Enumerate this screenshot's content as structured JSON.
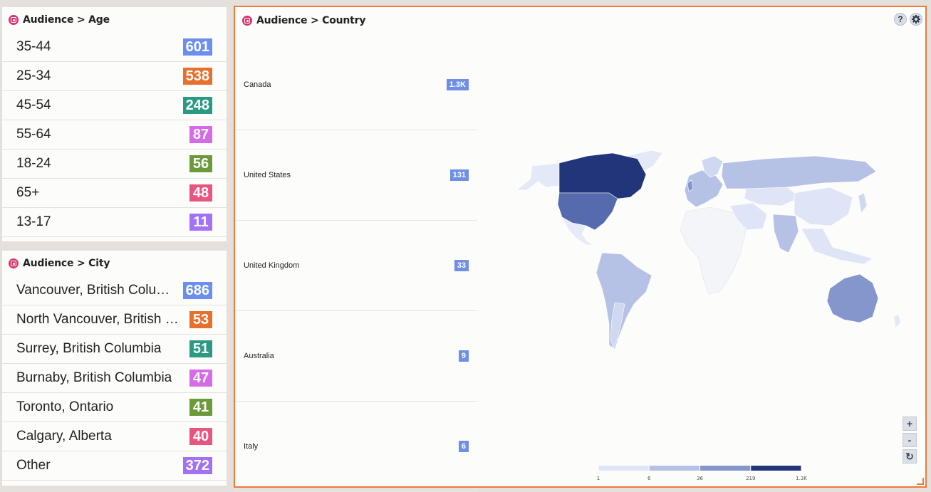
{
  "age_panel": {
    "title": "Audience > Age",
    "rows": [
      {
        "label": "35-44",
        "value": "601",
        "color": "#6b8ef0"
      },
      {
        "label": "25-34",
        "value": "538",
        "color": "#e8702d"
      },
      {
        "label": "45-54",
        "value": "248",
        "color": "#2b9a82"
      },
      {
        "label": "55-64",
        "value": "87",
        "color": "#d56be6"
      },
      {
        "label": "18-24",
        "value": "56",
        "color": "#6c9a3a"
      },
      {
        "label": "65+",
        "value": "48",
        "color": "#ea5580"
      },
      {
        "label": "13-17",
        "value": "11",
        "color": "#a371f5"
      }
    ]
  },
  "city_panel": {
    "title": "Audience > City",
    "rows": [
      {
        "label": "Vancouver, British Columbia",
        "value": "686",
        "color": "#6b8ef0"
      },
      {
        "label": "North Vancouver, British Columbia",
        "value": "53",
        "color": "#e8702d"
      },
      {
        "label": "Surrey, British Columbia",
        "value": "51",
        "color": "#2b9a82"
      },
      {
        "label": "Burnaby, British Columbia",
        "value": "47",
        "color": "#d56be6"
      },
      {
        "label": "Toronto, Ontario",
        "value": "41",
        "color": "#6c9a3a"
      },
      {
        "label": "Calgary, Alberta",
        "value": "40",
        "color": "#ea5580"
      },
      {
        "label": "Other",
        "value": "372",
        "color": "#a371f5"
      }
    ]
  },
  "country_panel": {
    "title": "Audience > Country",
    "help_label": "?",
    "rows": [
      {
        "name": "Canada",
        "value": "1.3K"
      },
      {
        "name": "United States",
        "value": "131"
      },
      {
        "name": "United Kingdom",
        "value": "33"
      },
      {
        "name": "Australia",
        "value": "9"
      },
      {
        "name": "Italy",
        "value": "6"
      }
    ],
    "zoom_in_label": "+",
    "zoom_out_label": "-",
    "reset_label": "↻",
    "legend": {
      "ticks": [
        "1",
        "6",
        "36",
        "219",
        "1.3K"
      ],
      "colors": [
        "#dfe5f7",
        "#b6c1e6",
        "#8596cd",
        "#566aae",
        "#22357a"
      ]
    }
  }
}
